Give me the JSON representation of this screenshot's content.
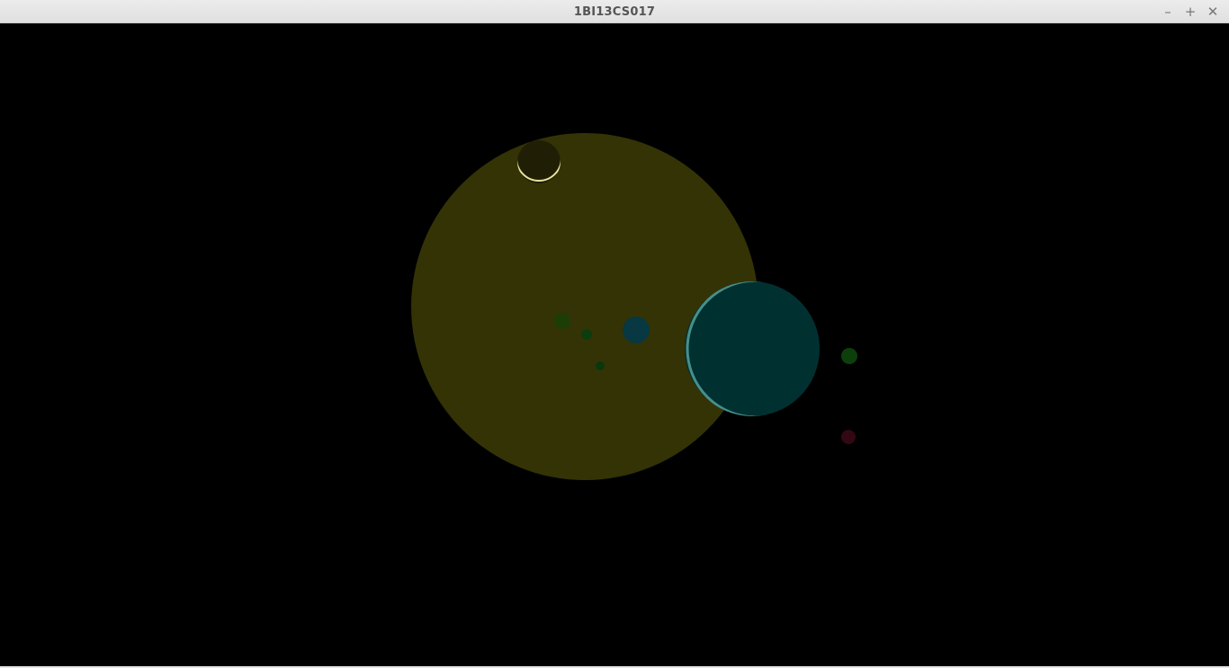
{
  "window": {
    "title": "1BI13CS017",
    "controls": {
      "minimize_icon": "minimize-icon",
      "maximize_icon": "maximize-icon",
      "close_icon": "close-icon",
      "minimize_glyph": "–",
      "maximize_glyph": "+",
      "close_glyph": "✕"
    }
  },
  "scene": {
    "background_color": "#000000",
    "bodies": [
      {
        "name": "large-yellow-sphere",
        "color": "#343306"
      },
      {
        "name": "dark-moon-sphere",
        "color": "#201f05",
        "highlight": "#e6e2a0"
      },
      {
        "name": "large-teal-sphere",
        "color": "#013030",
        "highlight": "#7fe0d8"
      },
      {
        "name": "small-teal-sphere",
        "color": "#083841"
      },
      {
        "name": "small-green-sphere-a",
        "color": "#1c3d06"
      },
      {
        "name": "small-green-sphere-b",
        "color": "#0d3d0d"
      },
      {
        "name": "small-green-sphere-c",
        "color": "#0b380b"
      },
      {
        "name": "green-sphere-right",
        "color": "#0c3f0c",
        "highlight": "#2a8a2a"
      },
      {
        "name": "red-sphere-right",
        "color": "#320812",
        "highlight": "#7a2a3a"
      }
    ]
  }
}
